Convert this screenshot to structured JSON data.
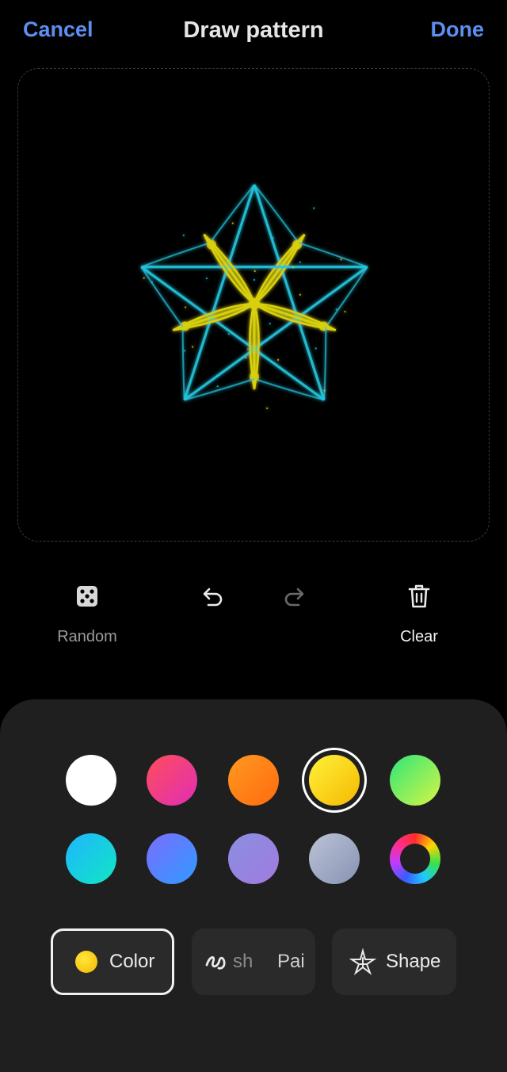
{
  "header": {
    "cancel_label": "Cancel",
    "title": "Draw pattern",
    "done_label": "Done"
  },
  "colors": {
    "accent": "#5b8ff0",
    "pattern_outer": "#23c4dd",
    "pattern_inner": "#d8d010"
  },
  "tools": {
    "random_label": "Random",
    "undo_icon": "undo-icon",
    "redo_icon": "redo-icon",
    "clear_label": "Clear"
  },
  "palette": {
    "row1": [
      {
        "name": "white",
        "from": "#ffffff",
        "to": "#ffffff"
      },
      {
        "name": "pink-red",
        "from": "#ff4d5a",
        "to": "#e02eb7"
      },
      {
        "name": "orange",
        "from": "#ff9a1f",
        "to": "#ff6a10"
      },
      {
        "name": "yellow",
        "from": "#fff23a",
        "to": "#f5b800",
        "selected": true
      },
      {
        "name": "green",
        "from": "#2ee67a",
        "to": "#d8f544"
      }
    ],
    "row2": [
      {
        "name": "cyan",
        "from": "#1fb6ff",
        "to": "#11e6c3"
      },
      {
        "name": "blue-violet",
        "from": "#7c6cff",
        "to": "#2f9bff"
      },
      {
        "name": "lavender",
        "from": "#8a8fe0",
        "to": "#a07bdf"
      },
      {
        "name": "grey-blue",
        "from": "#bcc3d6",
        "to": "#8793b3"
      },
      {
        "name": "spectrum",
        "from": "",
        "to": ""
      }
    ]
  },
  "tabs": {
    "color_label": "Color",
    "brush_label_left": "sh",
    "brush_label_right": "Pai",
    "shape_label": "Shape"
  }
}
